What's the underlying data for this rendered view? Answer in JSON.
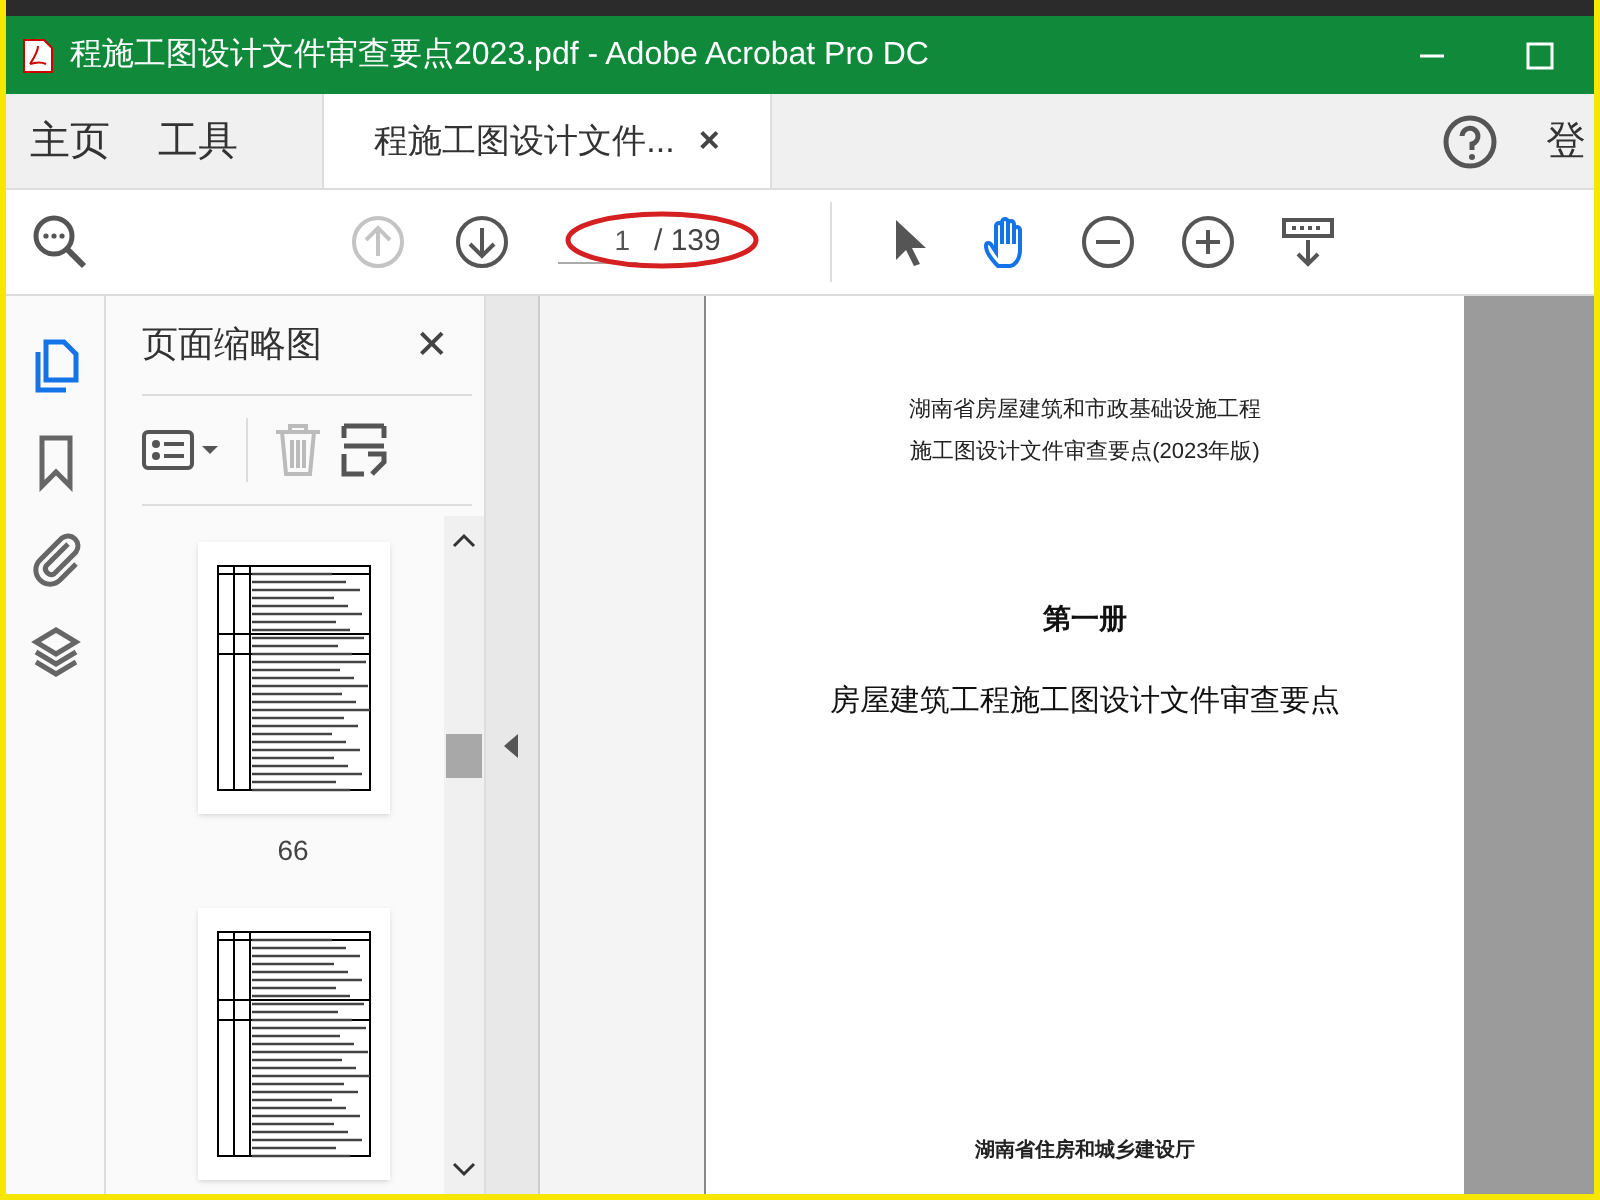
{
  "window": {
    "title": "程施工图设计文件审查要点2023.pdf - Adobe Acrobat Pro DC"
  },
  "tabs": [
    {
      "label": "主页",
      "kind": "menu",
      "selected": false
    },
    {
      "label": "工具",
      "kind": "menu",
      "selected": false
    },
    {
      "label": "程施工图设计文件...",
      "kind": "document",
      "selected": true,
      "close": "×"
    }
  ],
  "header_right": {
    "sign_in": "登"
  },
  "toolbar": {
    "prev_page": {
      "disabled": true
    },
    "next_page": {
      "disabled": false
    },
    "page_field": {
      "value": "1"
    },
    "page_total": "/ 139",
    "tools": [
      {
        "kind": "pointer",
        "selected": false
      },
      {
        "kind": "hand",
        "selected": true
      },
      {
        "kind": "zoom-out",
        "selected": false
      },
      {
        "kind": "zoom-in",
        "selected": false
      },
      {
        "kind": "scroll-mode",
        "selected": false
      }
    ]
  },
  "side_rail": [
    {
      "kind": "pages",
      "selected": true
    },
    {
      "kind": "bookmark",
      "selected": false
    },
    {
      "kind": "attachment",
      "selected": false
    },
    {
      "kind": "layers",
      "selected": false
    }
  ],
  "thumbnail_panel": {
    "title": "页面缩略图",
    "close": "✕",
    "thumbnails": [
      {
        "kind": "page",
        "label": "66"
      },
      {
        "kind": "page"
      }
    ]
  },
  "document": {
    "lines": [
      {
        "text": "湖南省房屋建筑和市政基础设施工程",
        "kind": "subtitle"
      },
      {
        "text": "施工图设计文件审查要点(2023年版)",
        "kind": "subtitle"
      },
      {
        "text": "第一册",
        "kind": "volume"
      },
      {
        "text": "房屋建筑工程施工图设计文件审查要点",
        "kind": "heading"
      },
      {
        "text": "湖南省住房和城乡建设厅",
        "kind": "footer"
      }
    ]
  }
}
